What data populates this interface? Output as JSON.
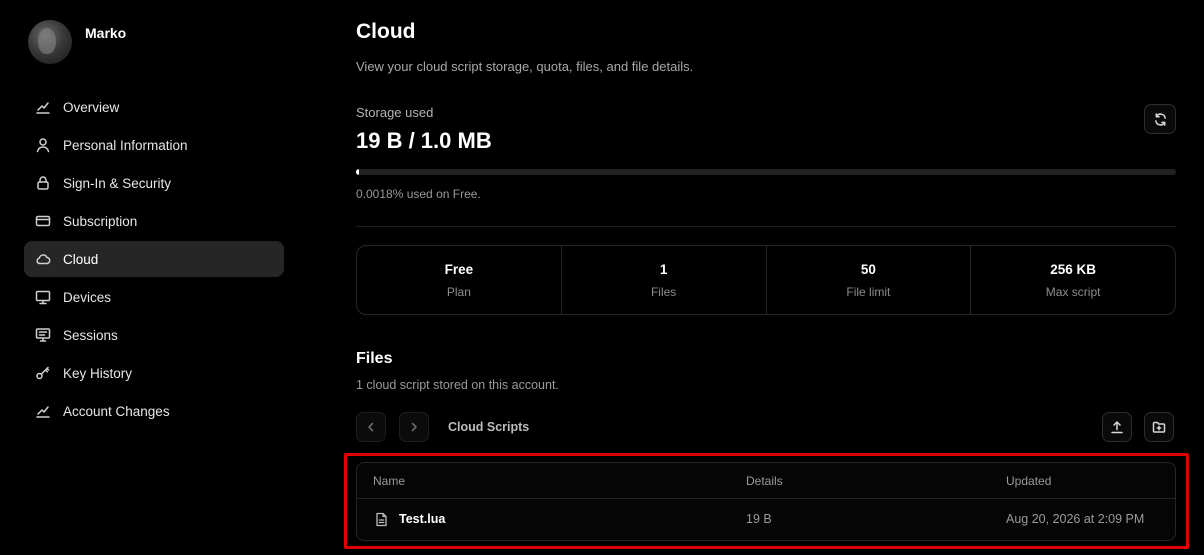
{
  "profile": {
    "name": "Marko"
  },
  "sidebar": {
    "items": [
      {
        "label": "Overview",
        "icon": "chart-icon",
        "active": false
      },
      {
        "label": "Personal Information",
        "icon": "user-icon",
        "active": false
      },
      {
        "label": "Sign-In & Security",
        "icon": "lock-icon",
        "active": false
      },
      {
        "label": "Subscription",
        "icon": "card-icon",
        "active": false
      },
      {
        "label": "Cloud",
        "icon": "cloud-icon",
        "active": true
      },
      {
        "label": "Devices",
        "icon": "monitor-icon",
        "active": false
      },
      {
        "label": "Sessions",
        "icon": "sessions-icon",
        "active": false
      },
      {
        "label": "Key History",
        "icon": "key-icon",
        "active": false
      },
      {
        "label": "Account Changes",
        "icon": "chart-icon",
        "active": false
      }
    ]
  },
  "page": {
    "title": "Cloud",
    "subtitle": "View your cloud script storage, quota, files, and file details."
  },
  "storage": {
    "label": "Storage used",
    "value": "19 B / 1.0 MB",
    "used_fraction": 1.8e-05,
    "usage_text": "0.0018% used on Free."
  },
  "stats": [
    {
      "value": "Free",
      "label": "Plan"
    },
    {
      "value": "1",
      "label": "Files"
    },
    {
      "value": "50",
      "label": "File limit"
    },
    {
      "value": "256 KB",
      "label": "Max script"
    }
  ],
  "files": {
    "title": "Files",
    "subtitle": "1 cloud script stored on this account.",
    "breadcrumb": "Cloud Scripts",
    "columns": {
      "name": "Name",
      "details": "Details",
      "updated": "Updated"
    },
    "rows": [
      {
        "name": "Test.lua",
        "details": "19 B",
        "updated": "Aug 20, 2026 at 2:09 PM"
      }
    ]
  },
  "colors": {
    "background": "#000000",
    "active_nav": "#262626",
    "highlight": "#e00000"
  }
}
